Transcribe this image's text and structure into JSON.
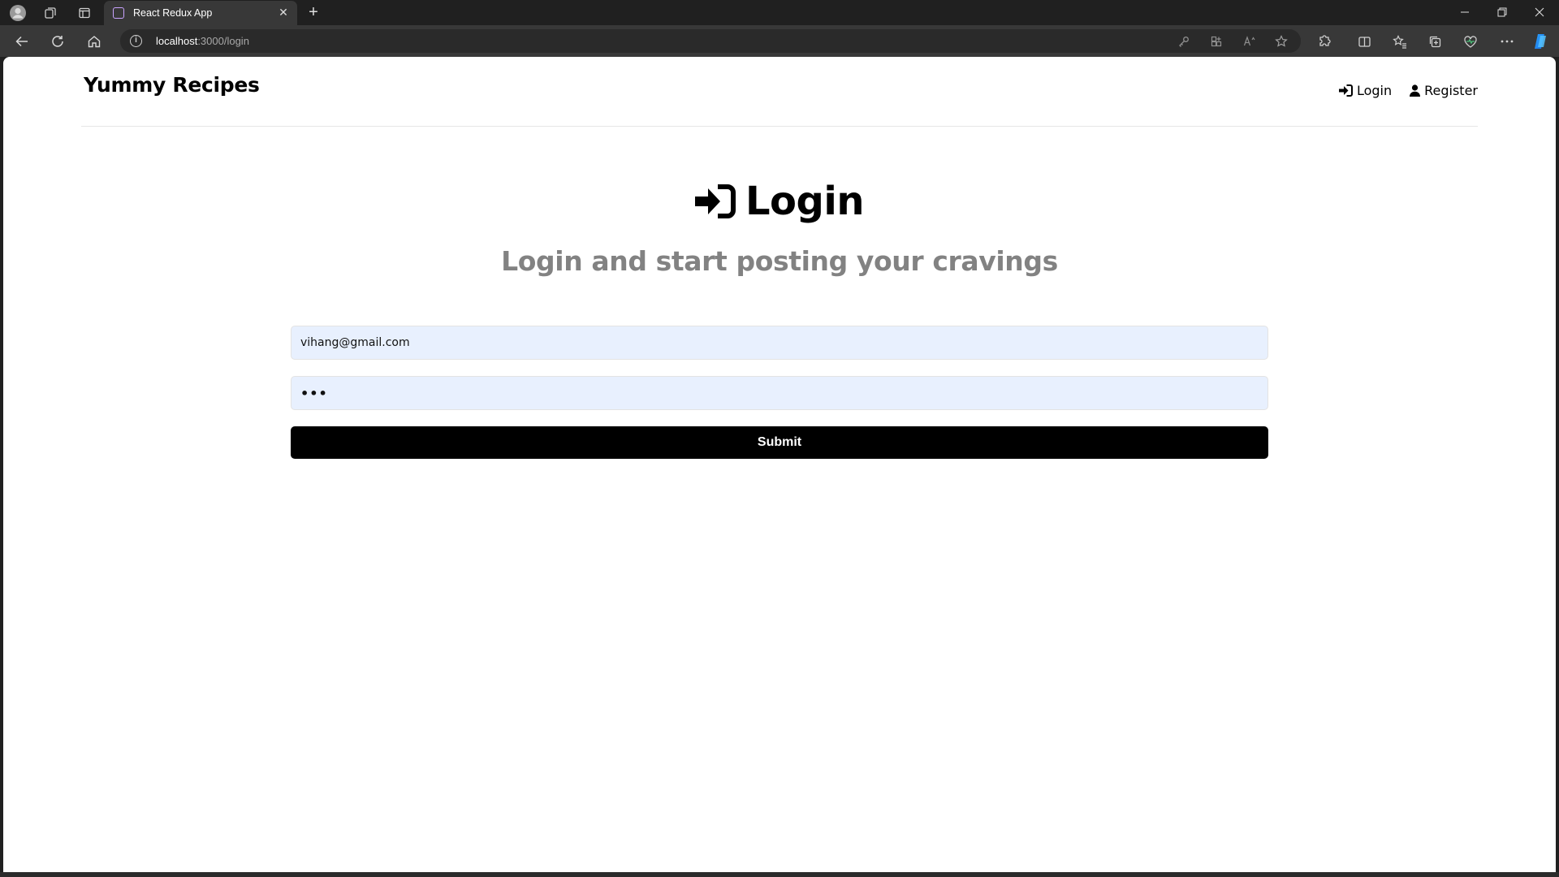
{
  "browser": {
    "tab_title": "React Redux App",
    "url_host": "localhost",
    "url_path": ":3000/login"
  },
  "app": {
    "brand": "Yummy Recipes",
    "nav": [
      {
        "label": "Login",
        "icon": "sign-in-icon"
      },
      {
        "label": "Register",
        "icon": "user-icon"
      }
    ]
  },
  "page": {
    "title": "Login",
    "title_icon": "sign-in-icon",
    "subtitle": "Login and start posting your cravings"
  },
  "form": {
    "email_value": "vihang@gmail.com",
    "password_masked": "•••",
    "submit_label": "Submit",
    "input_bg": "#e8f0fe",
    "button_bg": "#000000"
  }
}
